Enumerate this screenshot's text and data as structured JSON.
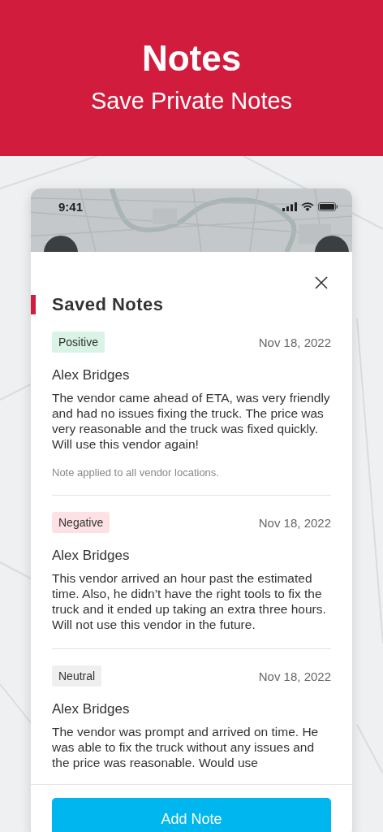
{
  "header": {
    "title": "Notes",
    "subtitle": "Save Private Notes"
  },
  "phone": {
    "status_bar": {
      "time": "9:41"
    }
  },
  "sheet": {
    "title": "Saved Notes",
    "notes": [
      {
        "tag": "Positive",
        "color": "#d9f3e6",
        "date": "Nov 18, 2022",
        "author": "Alex Bridges",
        "body": "The vendor came ahead of ETA, was very friendly and had no issues fixing the truck. The price was very reasonable and the truck was fixed quickly. Will use this vendor again!",
        "footnote": "Note applied to all vendor locations."
      },
      {
        "tag": "Negative",
        "color": "#fde1e5",
        "date": "Nov 18, 2022",
        "author": "Alex Bridges",
        "body": "This vendor arrived an hour past the estimated time. Also, he didn’t have the right tools to fix the truck and it ended up taking an extra three hours. Will not use this vendor in the future."
      },
      {
        "tag": "Neutral",
        "color": "#efefef",
        "date": "Nov 18, 2022",
        "author": "Alex Bridges",
        "body": "The vendor was prompt and arrived on time. He was able to fix the truck without any issues and the price was reasonable. Would use"
      }
    ],
    "button": "Add Note"
  }
}
